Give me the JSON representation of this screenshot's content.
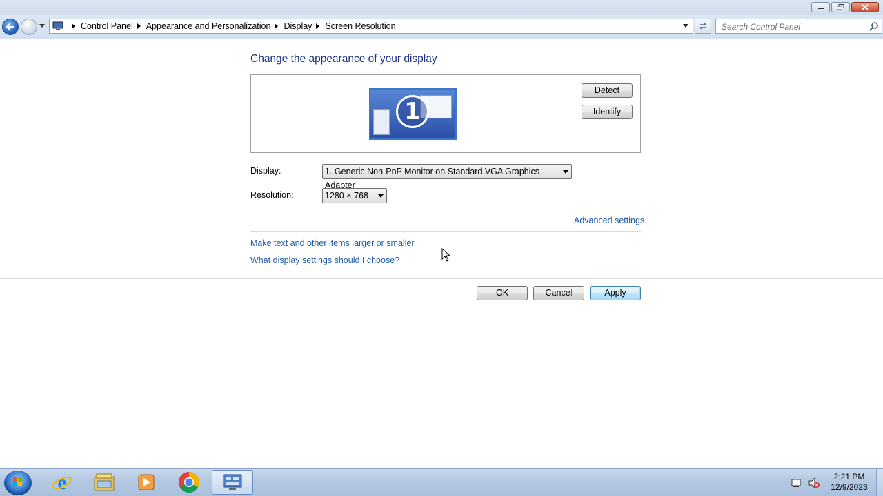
{
  "window": {
    "title": ""
  },
  "address": {
    "breadcrumbs": [
      "Control Panel",
      "Appearance and Personalization",
      "Display",
      "Screen Resolution"
    ],
    "search_placeholder": "Search Control Panel"
  },
  "main": {
    "heading": "Change the appearance of your display",
    "monitor_number": "1",
    "detect_label": "Detect",
    "identify_label": "Identify",
    "display_label": "Display:",
    "display_value": "1. Generic Non-PnP Monitor on Standard VGA Graphics Adapter",
    "resolution_label": "Resolution:",
    "resolution_value": "1280 × 768",
    "advanced_link": "Advanced settings",
    "link_text_size": "Make text and other items larger or smaller",
    "link_help": "What display settings should I choose?",
    "ok_label": "OK",
    "cancel_label": "Cancel",
    "apply_label": "Apply"
  },
  "taskbar": {
    "pinned": [
      "start-orb",
      "internet-explorer-icon",
      "windows-explorer-icon",
      "media-player-icon",
      "chrome-icon",
      "control-panel-icon"
    ],
    "time": "2:21 PM",
    "date": "12/9/2023"
  },
  "colors": {
    "heading": "#1e3287",
    "link": "#1e5aa8",
    "taskbar": "#b4c9e2"
  }
}
